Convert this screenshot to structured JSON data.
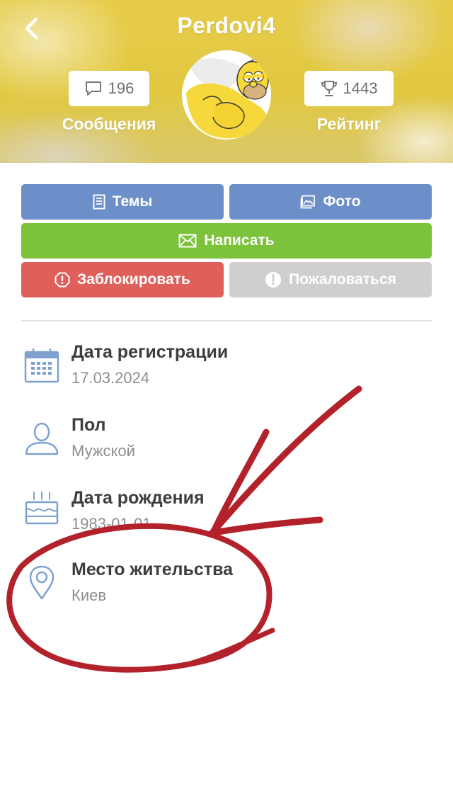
{
  "header": {
    "username": "Perdovi4",
    "messages": {
      "count": "196",
      "label": "Сообщения"
    },
    "rating": {
      "count": "1443",
      "label": "Рейтинг"
    }
  },
  "buttons": {
    "topics": "Темы",
    "photo": "Фото",
    "write": "Написать",
    "block": "Заблокировать",
    "report": "Пожаловаться"
  },
  "info": [
    {
      "label": "Дата регистрации",
      "value": "17.03.2024",
      "icon": "calendar-icon"
    },
    {
      "label": "Пол",
      "value": "Мужской",
      "icon": "user-icon"
    },
    {
      "label": "Дата рождения",
      "value": "1983-01-01",
      "icon": "birthday-cake-icon"
    },
    {
      "label": "Место жительства",
      "value": "Киев",
      "icon": "location-pin-icon"
    }
  ],
  "colors": {
    "header_yellow": "#e2c840",
    "button_blue": "#6c8fca",
    "button_green": "#7cc23b",
    "button_red": "#df5f5b",
    "button_gray": "#cfcfcf",
    "icon_blue": "#7fa1cf",
    "annotation_red": "#b3222a"
  }
}
